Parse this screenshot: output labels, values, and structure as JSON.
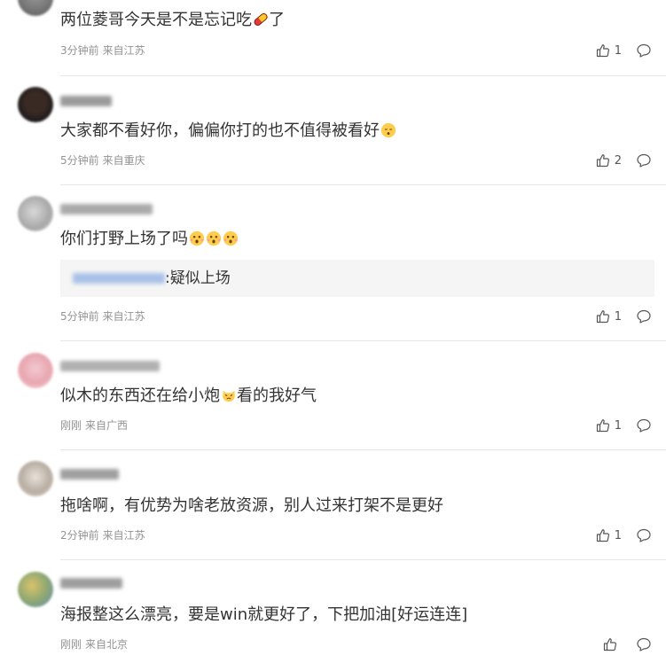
{
  "comments": [
    {
      "text": "两位菱哥今天是不是忘记吃",
      "text_after_emoji": "了",
      "emoji": "pill-emoji",
      "time": "3分钟前",
      "location": "来自江苏",
      "likes": "1"
    },
    {
      "text": "大家都不看好你，偏偏你打的也不值得被看好",
      "emoji": "sad-face-emoji",
      "time": "5分钟前",
      "location": "来自重庆",
      "likes": "2"
    },
    {
      "text": "你们打野上场了吗",
      "emoji": "shocked-face-emoji",
      "time": "5分钟前",
      "location": "来自江苏",
      "likes": "1",
      "reply": {
        "text": ":疑似上场"
      }
    },
    {
      "text": "似木的东西还在给小炮",
      "text_after_emoji": "看的我好气",
      "emoji": "angry-cat-emoji",
      "time": "刚刚",
      "location": "来自广西",
      "likes": "1"
    },
    {
      "text": "拖啥啊，有优势为啥老放资源，别人过来打架不是更好",
      "time": "2分钟前",
      "location": "来自江苏",
      "likes": "1"
    },
    {
      "text": "海报整这么漂亮，要是win就更好了，下把加油[好运连连]",
      "time": "刚刚",
      "location": "来自北京",
      "likes": ""
    }
  ],
  "icons": {
    "like": "thumbs-up-icon",
    "reply": "speech-bubble-icon"
  },
  "colors": {
    "text": "#333333",
    "meta": "#939393",
    "divider": "#e6e6e6",
    "quote_bg": "#f5f5f5"
  }
}
